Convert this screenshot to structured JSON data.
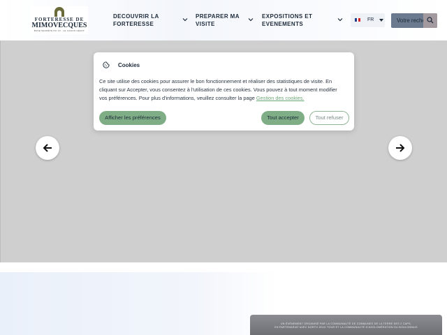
{
  "header": {
    "logo": {
      "line1": "FORTERESSE DE",
      "line2": "MIMOVECQUES",
      "line3": "BASE SECRÈTE DU V3 · LE CANON GÉANT"
    },
    "nav": [
      {
        "label_l1": "DECOUVRIR LA",
        "label_l2": "FORTERESSE"
      },
      {
        "label_l1": "PREPARER MA",
        "label_l2": "VISITE"
      },
      {
        "label_l1": "EXPOSITIONS ET",
        "label_l2": "EVENEMENTS"
      }
    ],
    "language": {
      "code": "FR",
      "flag_colors": [
        "#1f3c8c",
        "#ffffff",
        "#d42a2a"
      ]
    },
    "search": {
      "placeholder": "Votre recherche"
    }
  },
  "cookie": {
    "title": "Cookies",
    "text": "Ce site utilise des cookies pour assurer le bon fonctionnement et réaliser des statistiques de visite. En cliquant sur Accepter, vous consentez à l'utilisation de ces cookies. Vous pouvez à tout moment modifier vos préférences. Pour plus d'informations, veuillez consulter la page",
    "link": "Gestion des cookies.",
    "buttons": {
      "preferences": "Afficher les préférences",
      "accept": "Tout accepter",
      "refuse": "Tout refuser"
    }
  },
  "carousel": {
    "prev_icon": "arrow-left-icon",
    "next_icon": "arrow-right-icon"
  },
  "banner": {
    "line1": "UN ÉVÉNEMENT ORGANISÉ PAR LA COMMUNAUTÉ DE COMMUNES DE LA TERRE DES 2 CAPS,",
    "line2": "EN PARTENARIAT AVEC NORTH JEUX TOUR ET LA COMMUNAUTÉ D'AGGLOMÉRATION DU BOULONNAIS"
  },
  "colors": {
    "accent_green": "#7fae86",
    "search_bg": "#6b7a8e",
    "overlay_grey": "#cfcfcf"
  }
}
